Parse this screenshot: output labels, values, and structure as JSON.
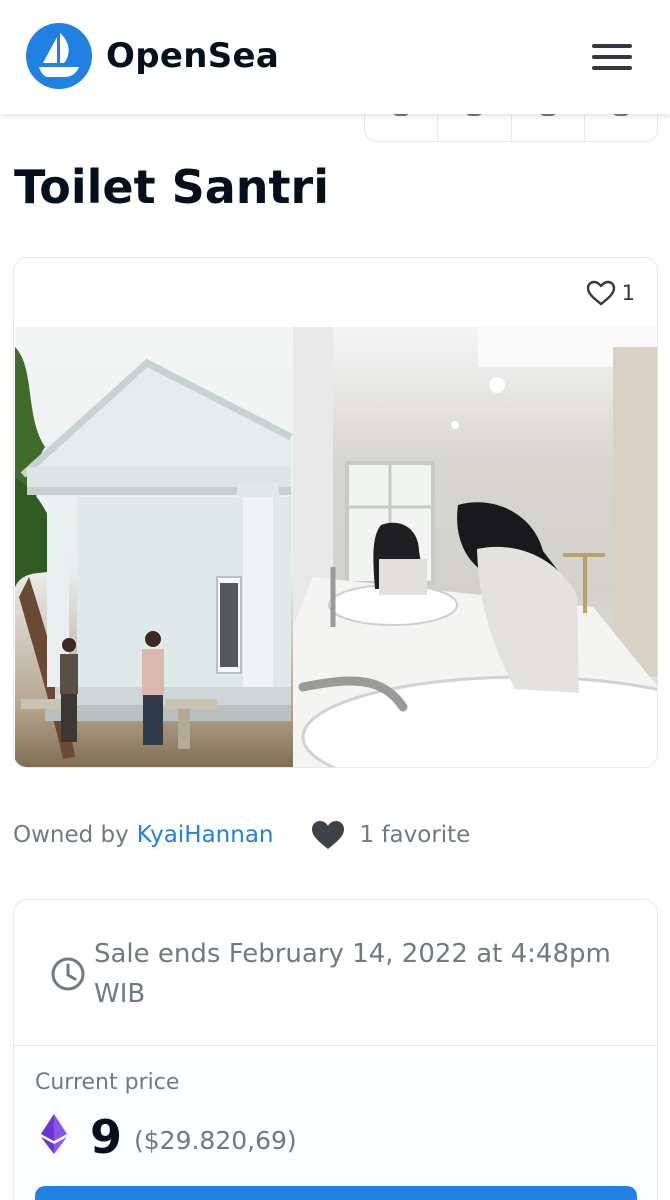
{
  "header": {
    "brand": "OpenSea"
  },
  "item": {
    "title": "Toilet Santri",
    "favorites_count": "1"
  },
  "ownership": {
    "owned_by_label": "Owned by",
    "owner_name": "KyaiHannan",
    "favorites_text": "1 favorite"
  },
  "sale": {
    "ends_text": "Sale ends February 14, 2022 at 4:48pm WIB",
    "current_price_label": "Current price",
    "price": "9",
    "price_fiat": "($29.820,69)"
  },
  "colors": {
    "accent": "#2081e2",
    "text_dark": "#04111d",
    "text_muted": "#707a83",
    "border": "#e5e8eb",
    "eth_purple": "#7b3fe4"
  },
  "icons": {
    "logo": "opensea-boat-icon",
    "menu": "hamburger-menu-icon",
    "favorite": "heart-icon",
    "timer": "clock-icon",
    "currency": "ethereum-icon"
  }
}
